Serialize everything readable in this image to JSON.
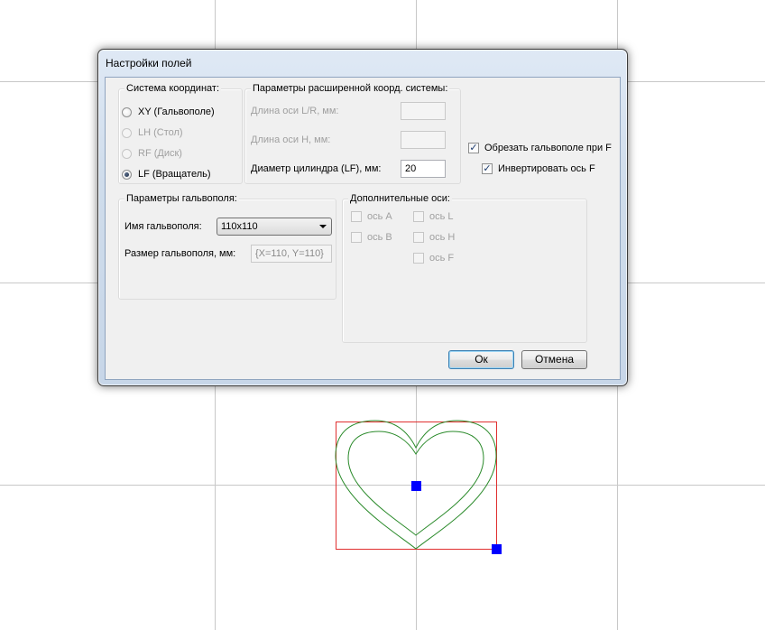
{
  "dialog": {
    "title": "Настройки полей",
    "coord_system": {
      "legend": "Система координат:",
      "options": [
        {
          "label": "XY (Гальвополе)",
          "enabled": true,
          "selected": false
        },
        {
          "label": "LH (Стол)",
          "enabled": false,
          "selected": false
        },
        {
          "label": "RF (Диск)",
          "enabled": false,
          "selected": false
        },
        {
          "label": "LF (Вращатель)",
          "enabled": true,
          "selected": true
        }
      ]
    },
    "extended": {
      "legend": "Параметры расширенной коорд. системы:",
      "axis_lr_label": "Длина оси L/R, мм:",
      "axis_lr_value": "",
      "axis_h_label": "Длина оси H, мм:",
      "axis_h_value": "",
      "diameter_label": "Диаметр цилиндра (LF), мм:",
      "diameter_value": "20"
    },
    "options": {
      "clip_label": "Обрезать гальвополе при F",
      "clip_checked": true,
      "invert_label": "Инвертировать ось F",
      "invert_checked": true
    },
    "galvo": {
      "legend": "Параметры гальвополя:",
      "name_label": "Имя гальвополя:",
      "name_value": "110x110",
      "size_label": "Размер гальвополя, мм:",
      "size_value": "{X=110, Y=110}"
    },
    "additional_axes": {
      "legend": "Дополнительные оси:",
      "axes": [
        {
          "label": "ось A",
          "checked": false
        },
        {
          "label": "ось B",
          "checked": false
        },
        {
          "label": "ось L",
          "checked": false
        },
        {
          "label": "ось H",
          "checked": false
        },
        {
          "label": "ось F",
          "checked": false
        }
      ]
    },
    "ok_label": "Ок",
    "cancel_label": "Отмена"
  },
  "canvas": {
    "colors": {
      "grid": "#c8c8c8",
      "bbox": "#e03030",
      "shape": "#2a8a2a",
      "handle": "#0000ff"
    }
  }
}
